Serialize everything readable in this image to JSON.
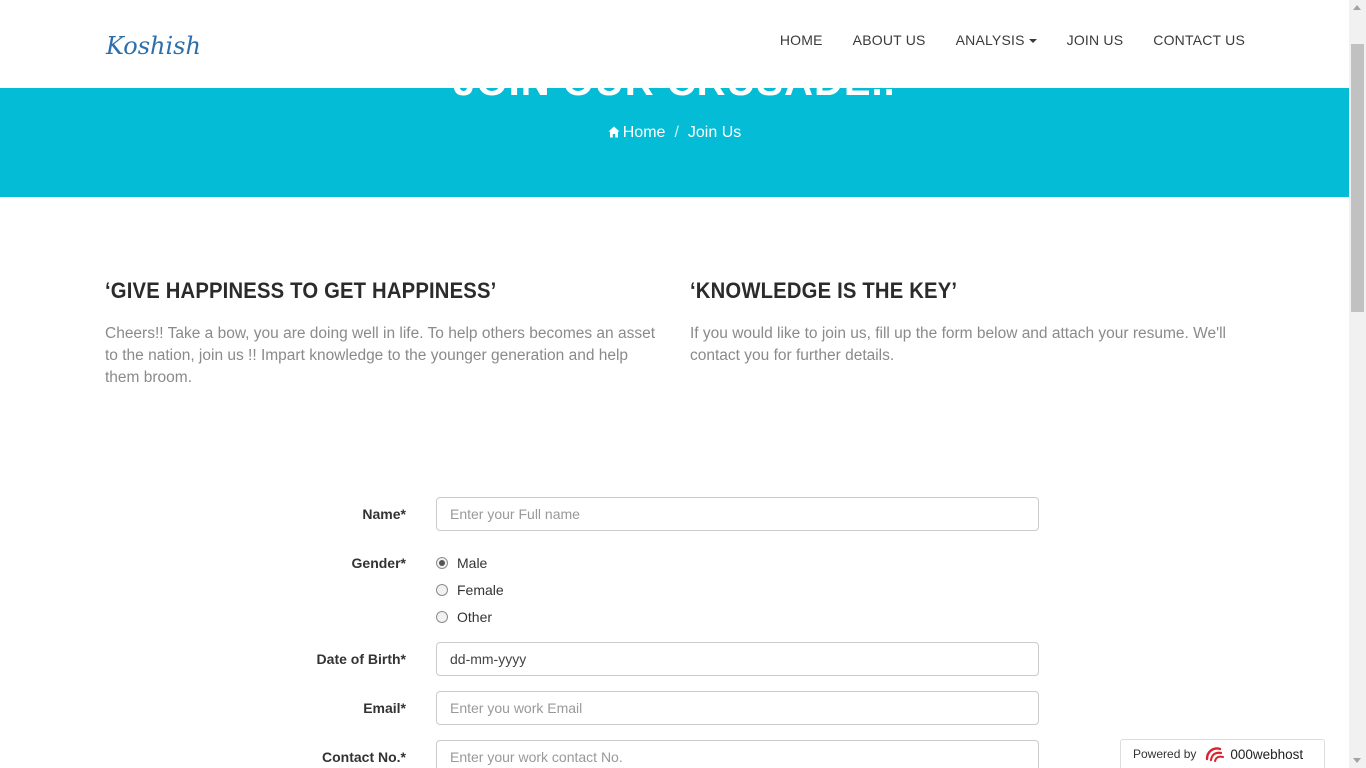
{
  "brand": "Koshish",
  "nav": {
    "items": [
      {
        "label": "HOME"
      },
      {
        "label": "ABOUT US"
      },
      {
        "label": "ANALYSIS"
      },
      {
        "label": "JOIN US"
      },
      {
        "label": "CONTACT US"
      }
    ]
  },
  "hero": {
    "title": "JOIN OUR CRUSADE..",
    "breadcrumb_home": "Home",
    "breadcrumb_separator": "/",
    "breadcrumb_current": "Join Us",
    "bg_color": "#05bcd6"
  },
  "columns": {
    "left": {
      "heading": "‘GIVE HAPPINESS TO GET HAPPINESS’",
      "text": "Cheers!! Take a bow, you are doing well in life. To help others becomes an asset to the nation, join us !! Impart knowledge to the younger generation and help them broom."
    },
    "right": {
      "heading": "‘KNOWLEDGE IS THE KEY’",
      "text": "If you would like to join us, fill up the form below and attach your resume. We'll contact you for further details."
    }
  },
  "form": {
    "name_label": "Name*",
    "name_placeholder": "Enter your Full name",
    "gender_label": "Gender*",
    "gender_options": [
      "Male",
      "Female",
      "Other"
    ],
    "gender_selected": "Male",
    "dob_label": "Date of Birth*",
    "dob_value": "dd-mm-yyyy",
    "email_label": "Email*",
    "email_placeholder": "Enter you work Email",
    "contact_label": "Contact No.*",
    "contact_placeholder": "Enter your work contact No."
  },
  "badge": {
    "powered": "Powered by",
    "brand": "000webhost"
  }
}
